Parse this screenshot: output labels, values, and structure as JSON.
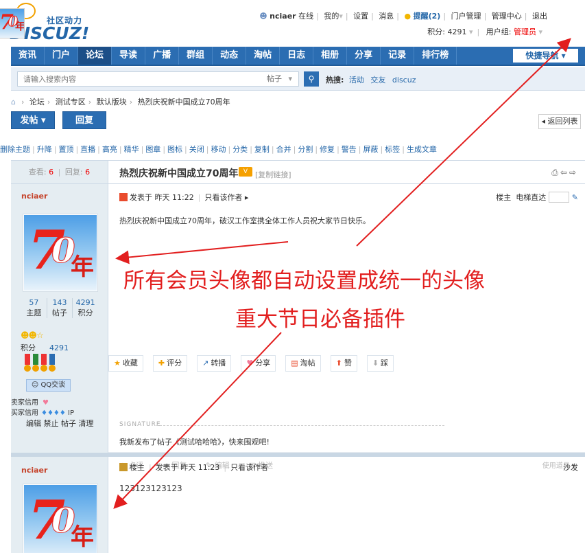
{
  "header": {
    "logo_cn": "社区动力",
    "logo_en": "DISCUZ!",
    "username": "nciaer",
    "online": "在线",
    "my": "我的",
    "settings": "设置",
    "messages": "消息",
    "remind": "提醒(2)",
    "portal_admin": "门户管理",
    "admin_center": "管理中心",
    "logout": "退出",
    "points_label": "积分: 4291",
    "group_label": "用户组:",
    "group_value": "管理员"
  },
  "nav": {
    "items": [
      "资讯",
      "门户",
      "论坛",
      "导读",
      "广播",
      "群组",
      "动态",
      "淘帖",
      "日志",
      "相册",
      "分享",
      "记录",
      "排行榜"
    ],
    "active": 2,
    "quick": "快捷导航"
  },
  "search": {
    "placeholder": "请输入搜索内容",
    "type": "帖子",
    "hot_label": "热搜:",
    "hot_words": [
      "活动",
      "交友",
      "discuz"
    ]
  },
  "breadcrumb": [
    "论坛",
    "测试专区",
    "默认版块",
    "热烈庆祝新中国成立70周年"
  ],
  "buttons": {
    "post": "发帖",
    "reply": "回复",
    "back": "返回列表"
  },
  "mod_tools": [
    "删除主题",
    "升降",
    "置顶",
    "直播",
    "高亮",
    "精华",
    "图章",
    "图标",
    "关闭",
    "移动",
    "分类",
    "复制",
    "合并",
    "分割",
    "修复",
    "警告",
    "屏蔽",
    "标签",
    "生成文章"
  ],
  "thread": {
    "views_label": "查看:",
    "views": "6",
    "replies_label": "回复:",
    "replies": "6",
    "title": "热烈庆祝新中国成立70周年",
    "copy_link": "[复制链接]"
  },
  "post1": {
    "author": "nciaer",
    "posted": "发表于 昨天 11:22",
    "only_author": "只看该作者",
    "floor_owner": "楼主",
    "floor_jump": "电梯直达",
    "body": "热烈庆祝新中国成立70周年，破汉工作室携全体工作人员祝大家节日快乐。",
    "stats": [
      {
        "value": "57",
        "label": "主题"
      },
      {
        "value": "143",
        "label": "帖子"
      },
      {
        "value": "4291",
        "label": "积分"
      }
    ],
    "points_label": "积分",
    "points_value": "4291",
    "qq": "QQ交谈",
    "seller_credit": "卖家信用",
    "buyer_credit": "买家信用",
    "ip": "IP",
    "admin_links": "编辑 禁止 帖子 清理",
    "actions": [
      {
        "icon": "star-icon",
        "label": "收藏"
      },
      {
        "icon": "rate-icon",
        "label": "评分"
      },
      {
        "icon": "share-out-icon",
        "label": "转播"
      },
      {
        "icon": "heart-icon",
        "label": "分享"
      },
      {
        "icon": "collect-icon",
        "label": "淘帖"
      },
      {
        "icon": "thumb-up-icon",
        "label": "赞"
      },
      {
        "icon": "thumb-down-icon",
        "label": "踩"
      }
    ],
    "sig_label": "SIGNATURE",
    "sig_text": "我新发布了帖子《测试哈哈哈》，快来围观吧!",
    "foot": [
      "点评",
      "回复",
      "编辑",
      "推送"
    ],
    "use_tool": "使用道具"
  },
  "post2": {
    "author": "nciaer",
    "owner_tag": "楼主",
    "posted": "发表于 昨天 11:23",
    "only_author": "只看该作者",
    "floor": "沙发",
    "body": "123123123123"
  },
  "avatar_text": {
    "seven": "7",
    "zero": "0",
    "nian": "年"
  },
  "annotations": {
    "line1": "所有会员头像都自动设置成统一的头像",
    "line2": "重大节日必备插件"
  },
  "colors": {
    "nav": "#2b6db2",
    "accent_red": "#e21f1f",
    "author": "#c5432b"
  }
}
